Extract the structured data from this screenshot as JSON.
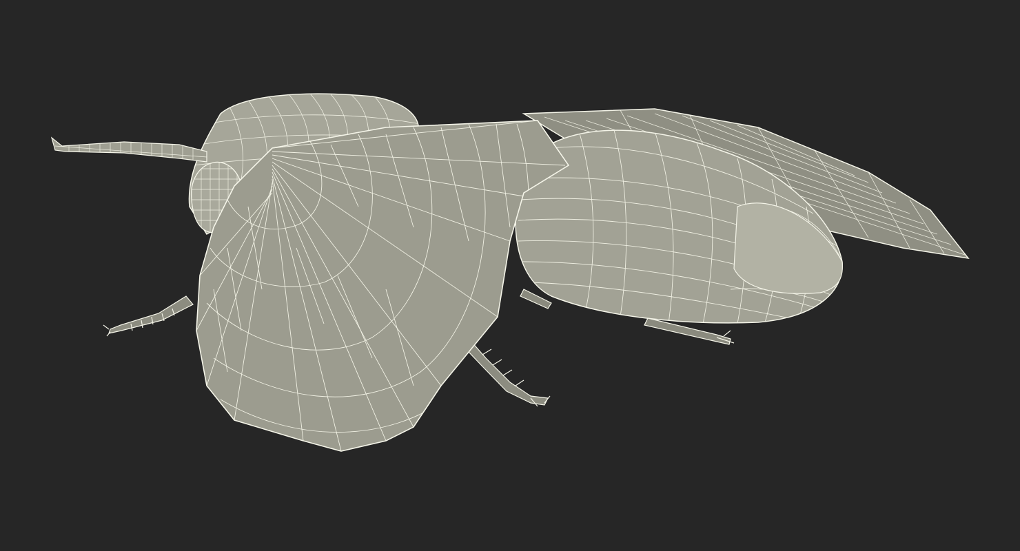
{
  "scene": {
    "background_color": "#262626",
    "mesh_fill_color": "#9a9a8c",
    "mesh_shade_color": "#7c7c70",
    "wireframe_color": "#f4f4e8",
    "subject_icon": "wireframe-moth-model"
  }
}
